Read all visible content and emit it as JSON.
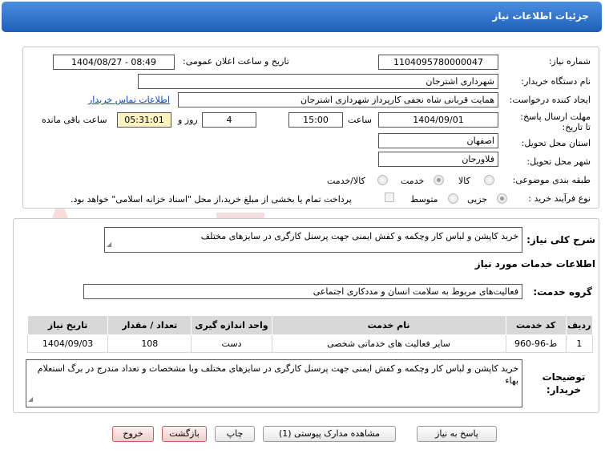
{
  "title": "جزئیات اطلاعات نیاز",
  "labels": {
    "need_number": "شماره نیاز:",
    "announce_datetime": "تاریخ و ساعت اعلان عمومی:",
    "buyer_org": "نام دستگاه خریدار:",
    "creator": "ایجاد کننده درخواست:",
    "deadline": "مهلت ارسال پاسخ: تا تاریخ:",
    "time": "ساعت",
    "day_and": "روز و",
    "remaining": "ساعت باقی مانده",
    "province": "استان محل تحویل:",
    "city": "شهر محل تحویل:",
    "category": "طبقه بندی موضوعی:",
    "process_type": "نوع فرآیند خرید :",
    "summary": "شرح کلی نیاز:",
    "services_heading": "اطلاعات خدمات مورد نیاز",
    "service_group": "گروه خدمت:",
    "buyer_notes": "توضیحات خریدار:"
  },
  "values": {
    "need_number": "1104095780000047",
    "announce_datetime": "1404/08/27 - 08:49",
    "buyer_org": "شهرداری اشترجان",
    "creator": "همایت قربانی شاه نجفی کارپرداز شهرداری اشترجان",
    "contact_link": "اطلاعات تماس خریدار",
    "deadline_date": "1404/09/01",
    "deadline_time": "15:00",
    "days": "4",
    "remaining_time": "05:31:01",
    "province": "اصفهان",
    "city": "فلاورجان",
    "summary": "خرید کاپشن و لباس کار وچکمه و کفش ایمنی جهت پرسنل کارگری در سایزهای مختلف",
    "service_group": "فعالیت‌های مربوط به سلامت انسان و مددکاری اجتماعی",
    "buyer_notes": "خرید کاپشن و لباس کار وچکمه و کفش ایمنی جهت پرسنل کارگری در سایزهای مختلف وبا مشخصات  و تعداد مندرج در برگ استعلام بهاء"
  },
  "category_options": [
    {
      "label": "کالا",
      "selected": false
    },
    {
      "label": "خدمت",
      "selected": true
    },
    {
      "label": "کالا/خدمت",
      "selected": false
    }
  ],
  "process_options": [
    {
      "label": "جزیی",
      "selected": true
    },
    {
      "label": "متوسط",
      "selected": false
    }
  ],
  "payment_note": "پرداخت تمام یا بخشی از مبلغ خرید،از محل \"اسناد خزانه اسلامی\" خواهد بود.",
  "table": {
    "headers": [
      "ردیف",
      "کد خدمت",
      "نام خدمت",
      "واحد اندازه گیری",
      "تعداد / مقدار",
      "تاریخ نیاز"
    ],
    "rows": [
      [
        "1",
        "ط-96-960",
        "سایر فعالیت های خدماتی شخصی",
        "دست",
        "108",
        "1404/09/03"
      ]
    ]
  },
  "buttons": {
    "reply": "پاسخ به نیاز",
    "attachments": "مشاهده مدارک پیوستی (1)",
    "print": "چاپ",
    "back": "بازگشت",
    "exit": "خروج"
  },
  "colors": {
    "title_bar": "#2f74cc",
    "remaining_bg": "#fdf3bf",
    "link": "#1144cc"
  }
}
